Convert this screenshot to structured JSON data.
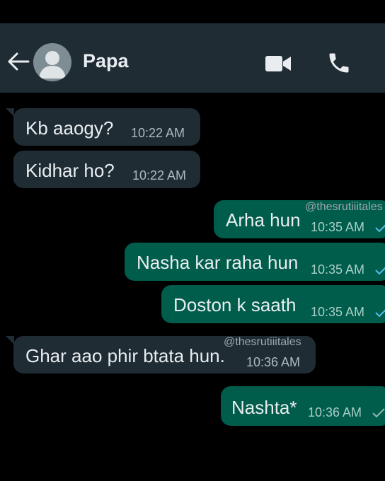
{
  "header": {
    "contact_name": "Papa",
    "back_icon": "arrow-left-icon",
    "video_icon": "video-call-icon",
    "call_icon": "phone-icon"
  },
  "messages": [
    {
      "direction": "in",
      "text": "Kb aaogy?",
      "time": "10:22 AM"
    },
    {
      "direction": "in",
      "text": "Kidhar ho?",
      "time": "10:22 AM"
    },
    {
      "direction": "out",
      "text": "Arha hun",
      "time": "10:35 AM"
    },
    {
      "direction": "out",
      "text": "Nasha kar raha hun",
      "time": "10:35 AM"
    },
    {
      "direction": "out",
      "text": "Doston k saath",
      "time": "10:35 AM"
    },
    {
      "direction": "in",
      "text": "Ghar aao phir btata hun.",
      "time": "10:36 AM"
    },
    {
      "direction": "out",
      "text": "Nashta*",
      "time": "10:36 AM"
    }
  ],
  "watermark": "@thesrutiiitales",
  "colors": {
    "background": "#000000",
    "header": "#1f2c34",
    "incoming": "#1f2c34",
    "outgoing": "#005c4b",
    "tick": "#53bdeb"
  }
}
